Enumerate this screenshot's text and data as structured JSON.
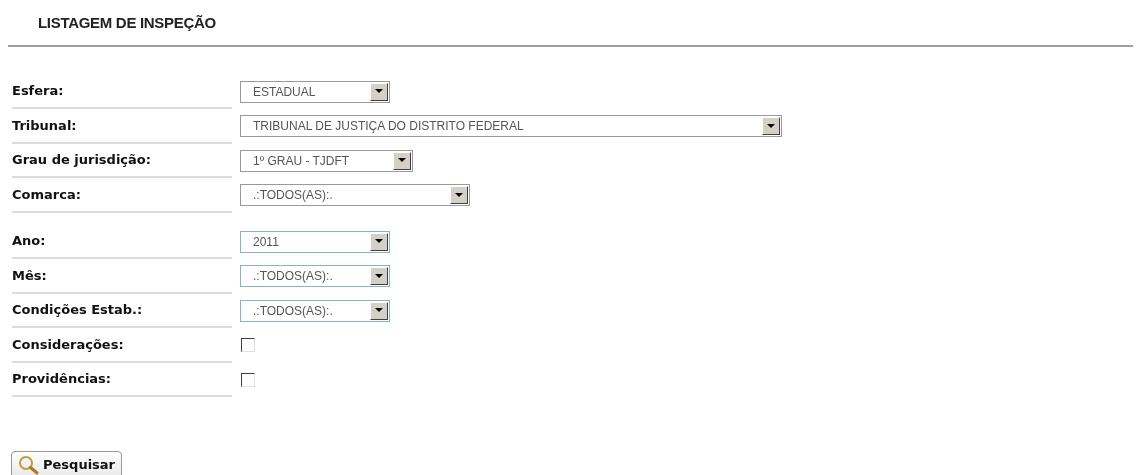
{
  "title": "LISTAGEM DE INSPEÇÃO",
  "groups": [
    {
      "fields": [
        {
          "label": "Esfera:",
          "kind": "select",
          "value": "ESTADUAL"
        },
        {
          "label": "Tribunal:",
          "kind": "select",
          "value": "TRIBUNAL DE JUSTIÇA DO DISTRITO FEDERAL"
        },
        {
          "label": "Grau de jurisdição:",
          "kind": "select",
          "value": "1º GRAU - TJDFT"
        },
        {
          "label": "Comarca:",
          "kind": "select",
          "value": ".:TODOS(AS):."
        }
      ]
    },
    {
      "fields": [
        {
          "label": "Ano:",
          "kind": "select",
          "value": "2011"
        },
        {
          "label": "Mês:",
          "kind": "select",
          "value": ".:TODOS(AS):."
        },
        {
          "label": "Condições Estab.:",
          "kind": "select",
          "value": ".:TODOS(AS):."
        },
        {
          "label": "Considerações:",
          "kind": "checkbox",
          "checked": false
        },
        {
          "label": "Providências:",
          "kind": "checkbox",
          "checked": false
        }
      ]
    }
  ],
  "button": "Pesquisar"
}
